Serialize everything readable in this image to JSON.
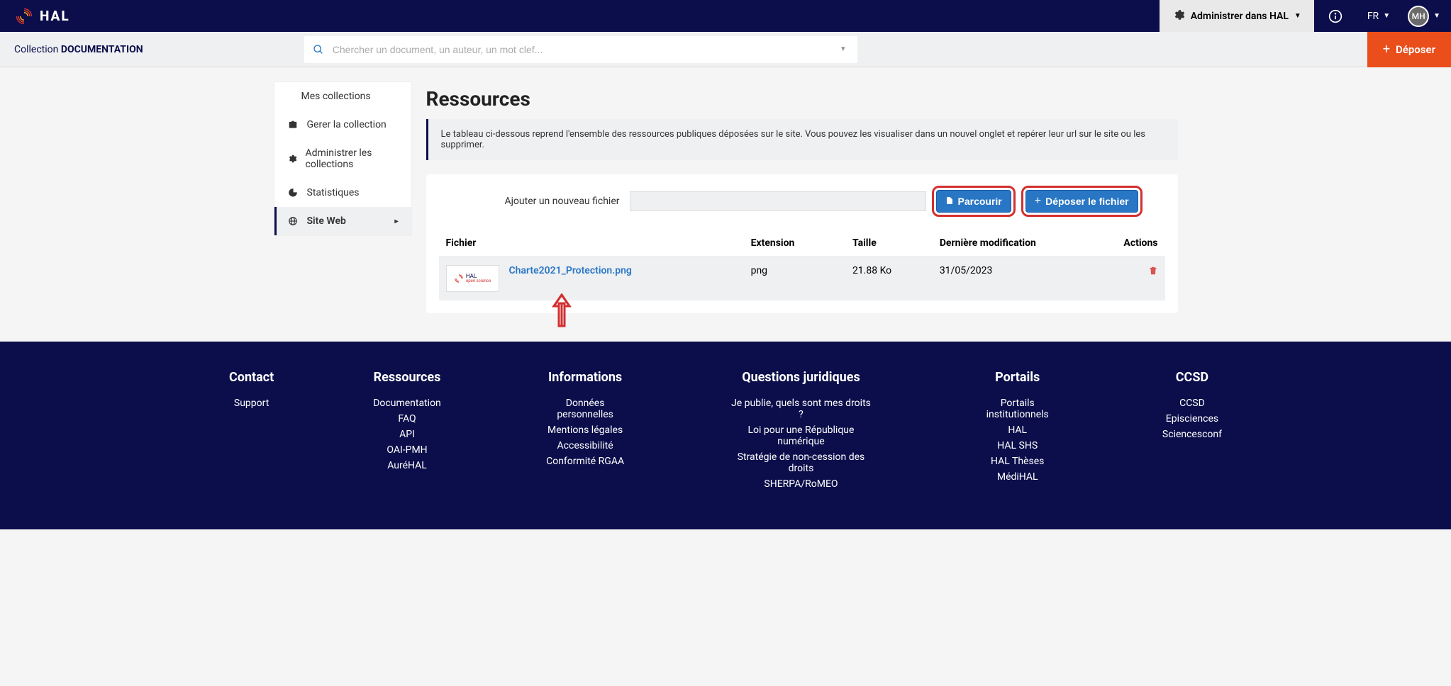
{
  "header": {
    "logo_text": "HAL",
    "admin_label": "Administrer dans HAL",
    "lang": "FR",
    "avatar_initials": "MH"
  },
  "subheader": {
    "collection_prefix": "Collection ",
    "collection_name": "DOCUMENTATION",
    "search_placeholder": "Chercher un document, un auteur, un mot clef...",
    "deposer_label": "Déposer"
  },
  "sidebar": {
    "title": "Mes collections",
    "items": [
      {
        "label": "Gerer la collection"
      },
      {
        "label": "Administrer les collections"
      },
      {
        "label": "Statistiques"
      },
      {
        "label": "Site Web"
      }
    ]
  },
  "page": {
    "title": "Ressources",
    "info": "Le tableau ci-dessous reprend l'ensemble des ressources publiques déposées sur le site. Vous pouvez les visualiser dans un nouvel onglet et repérer leur url sur le site ou les supprimer.",
    "upload_label": "Ajouter un nouveau fichier",
    "browse_btn": "Parcourir",
    "submit_btn": "Déposer le fichier"
  },
  "table": {
    "headers": {
      "file": "Fichier",
      "extension": "Extension",
      "size": "Taille",
      "modified": "Dernière modification",
      "actions": "Actions"
    },
    "rows": [
      {
        "filename": "Charte2021_Protection.png",
        "extension": "png",
        "size": "21.88 Ko",
        "modified": "31/05/2023",
        "thumb_text": "HAL",
        "thumb_sub": "open science"
      }
    ]
  },
  "footer": {
    "cols": [
      {
        "title": "Contact",
        "links": [
          "Support"
        ]
      },
      {
        "title": "Ressources",
        "links": [
          "Documentation",
          "FAQ",
          "API",
          "OAI-PMH",
          "AuréHAL"
        ]
      },
      {
        "title": "Informations",
        "links": [
          "Données personnelles",
          "Mentions légales",
          "Accessibilité",
          "Conformité RGAA"
        ]
      },
      {
        "title": "Questions juridiques",
        "links": [
          "Je publie, quels sont mes droits ?",
          "Loi pour une République numérique",
          "Stratégie de non-cession des droits",
          "SHERPA/RoMEO"
        ]
      },
      {
        "title": "Portails",
        "links": [
          "Portails institutionnels",
          "HAL",
          "HAL SHS",
          "HAL Thèses",
          "MédiHAL"
        ]
      },
      {
        "title": "CCSD",
        "links": [
          "CCSD",
          "Episciences",
          "Sciencesconf"
        ]
      }
    ]
  }
}
